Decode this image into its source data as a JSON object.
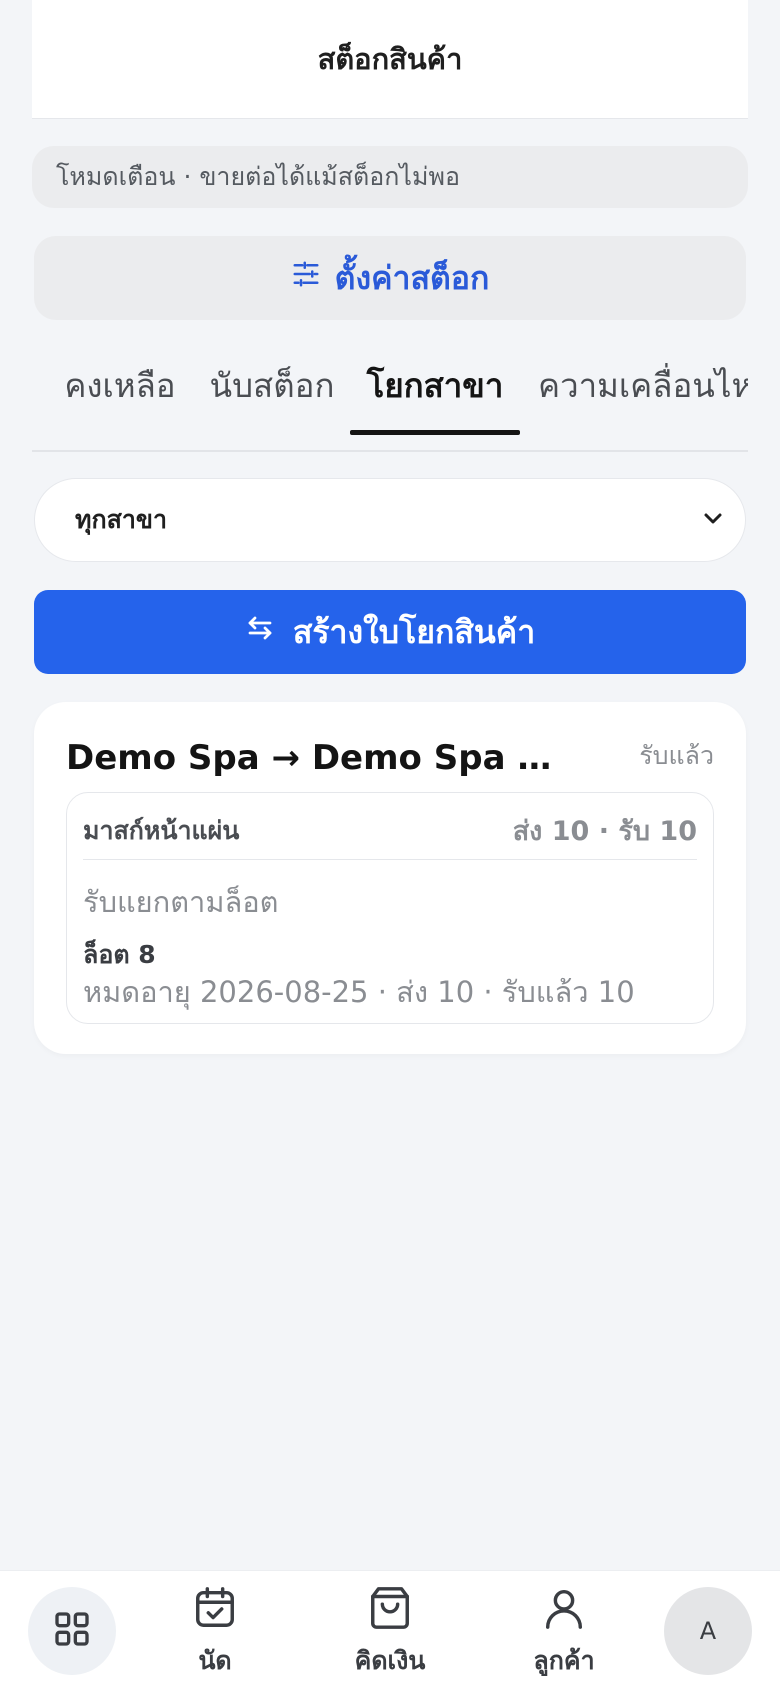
{
  "header": {
    "title": "สต็อกสินค้า"
  },
  "notice": {
    "text": "โหมดเตือน · ขายต่อได้แม้สต็อกไม่พอ"
  },
  "settings_button": {
    "label": "ตั้งค่าสต็อก",
    "icon": "sliders-icon"
  },
  "tabs": [
    {
      "label": "คงเหลือ",
      "active": false
    },
    {
      "label": "นับสต็อก",
      "active": false
    },
    {
      "label": "โยกสาขา",
      "active": true
    },
    {
      "label": "ความเคลื่อนไหว",
      "active": false
    }
  ],
  "branch_select": {
    "value": "ทุกสาขา"
  },
  "create_button": {
    "label": "สร้างใบโยกสินค้า",
    "icon": "swap-arrows-icon"
  },
  "transfer": {
    "title": "Demo Spa → Demo Spa สาขาลาดพร้าว",
    "status": "รับแล้ว",
    "item": {
      "name": "มาสก์หน้าแผ่น",
      "quantity": "ส่ง 10 · รับ 10",
      "receive_mode": "รับแยกตามล็อต",
      "lot": "ล็อต 8",
      "lot_detail": "หมดอายุ 2026-08-25 · ส่ง 10 · รับแล้ว 10"
    }
  },
  "bottom_nav": {
    "items": [
      {
        "label": "นัด",
        "icon": "calendar-check-icon"
      },
      {
        "label": "คิดเงิน",
        "icon": "shopping-bag-icon"
      },
      {
        "label": "ลูกค้า",
        "icon": "user-icon"
      }
    ],
    "avatar": "A"
  },
  "colors": {
    "accent": "#2563eb",
    "background": "#f3f5f8"
  }
}
